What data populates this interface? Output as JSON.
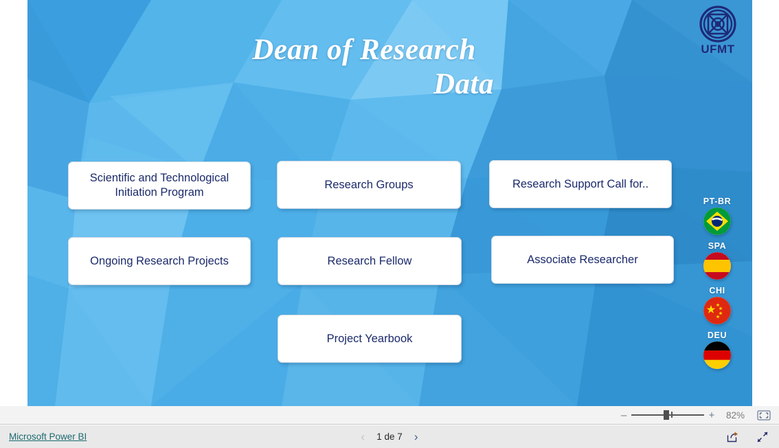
{
  "report": {
    "title_line1": "Dean of Research",
    "title_line2": "Data",
    "logo_text": "UFMT",
    "buttons": [
      {
        "label": "Scientific and Technological Initiation Program",
        "name": "scientific-technological-initiation-program"
      },
      {
        "label": "Research Groups",
        "name": "research-groups"
      },
      {
        "label": "Research Support Call for..",
        "name": "research-support-call-for"
      },
      {
        "label": "Ongoing Research Projects",
        "name": "ongoing-research-projects"
      },
      {
        "label": "Research Fellow",
        "name": "research-fellow"
      },
      {
        "label": "Associate Researcher",
        "name": "associate-researcher"
      },
      {
        "label": "Project Yearbook",
        "name": "project-yearbook"
      }
    ],
    "languages": [
      {
        "code": "PT-BR",
        "flag": "brazil-flag"
      },
      {
        "code": "SPA",
        "flag": "spain-flag"
      },
      {
        "code": "CHI",
        "flag": "china-flag"
      },
      {
        "code": "DEU",
        "flag": "germany-flag"
      }
    ]
  },
  "zoombar": {
    "minus_label": "–",
    "plus_label": "+",
    "zoom_level": "82%",
    "fit_icon": "fit-to-page-icon"
  },
  "bottombar": {
    "brand_link": "Microsoft Power BI",
    "prev_label": "‹",
    "next_label": "›",
    "page_label": "1 de 7",
    "share_icon": "share-icon",
    "fullscreen_icon": "fullscreen-icon"
  },
  "colors": {
    "canvas_blue": "#3fa3e0",
    "canvas_blue_dark": "#2f8cc6",
    "button_text": "#1b2a6b",
    "logo_navy": "#1e2a78",
    "link_teal": "#1b6a6f"
  }
}
